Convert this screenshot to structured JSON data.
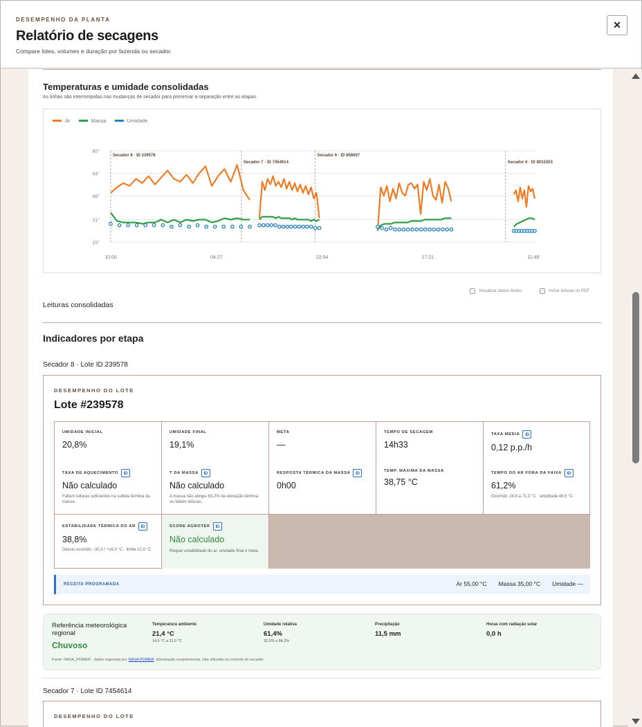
{
  "header": {
    "eyebrow": "DESEMPENHO DA PLANTA",
    "title": "Relatório de secagens",
    "subtitle": "Compare lotes, volumes e duração por fazenda ou secador.",
    "close_label": "✕"
  },
  "temps_section": {
    "title": "Temperaturas e umidade consolidadas",
    "subtitle": "As linhas são interrompidas nas mudanças de secador para preservar a separação entre as etapas."
  },
  "chart_data": {
    "type": "line",
    "legend": [
      {
        "name": "Ar",
        "color": "#f07b22"
      },
      {
        "name": "Massa",
        "color": "#2e9e44"
      },
      {
        "name": "Umidade",
        "color": "#1f7fbf"
      }
    ],
    "y_ticks": [
      "80°",
      "64°",
      "48°",
      "31°",
      "15°"
    ],
    "x_ticks": [
      "10:00",
      "04:27",
      "22:54",
      "17:21",
      "11:48"
    ],
    "ylim": [
      15,
      80
    ],
    "markers": [
      {
        "label": "Secador 8 · ID 239578"
      },
      {
        "label": "Secador 7 · ID 7454614"
      },
      {
        "label": "Secador 6 · ID 858607"
      },
      {
        "label": "Secador 6 · ID 8015303"
      }
    ],
    "segments": [
      {
        "x": [
          0,
          10
        ],
        "ar": [
          50,
          54,
          57,
          55,
          60,
          57,
          62,
          56,
          61,
          66,
          60,
          58,
          63,
          57,
          64,
          69,
          55,
          62,
          67,
          58,
          70,
          52,
          45
        ],
        "massa": [
          36,
          30,
          29,
          29,
          29,
          28,
          29,
          29,
          31,
          29,
          31,
          29,
          31,
          30,
          31,
          31,
          29,
          30,
          32,
          31,
          32,
          31,
          31
        ],
        "umidade": [
          28,
          27,
          27,
          27,
          27,
          27,
          27,
          26,
          27,
          26,
          27,
          26,
          26,
          26,
          26,
          26,
          26
        ]
      },
      {
        "x": [
          10.7,
          15
        ],
        "ar": [
          32,
          58,
          52,
          60,
          56,
          62,
          55,
          58,
          54,
          60,
          53,
          58,
          52,
          57,
          51,
          56,
          50,
          55,
          49,
          54,
          46,
          50,
          32
        ],
        "massa": [
          31,
          33,
          33,
          33,
          33,
          33,
          32,
          33,
          32,
          32,
          32,
          32,
          31,
          32,
          31,
          31,
          31,
          31,
          31,
          30,
          31,
          30,
          31
        ],
        "umidade": [
          27,
          27,
          27,
          27,
          27,
          26,
          26,
          26,
          26,
          26,
          26,
          26,
          26,
          26,
          25,
          25
        ]
      },
      {
        "x": [
          19.2,
          24.5
        ],
        "ar": [
          23,
          54,
          48,
          55,
          44,
          53,
          46,
          57,
          50,
          48,
          56,
          57,
          53,
          56,
          35,
          58,
          52,
          60,
          48,
          45,
          56,
          43,
          58,
          53,
          44
        ],
        "massa": [
          24,
          27,
          28,
          28,
          28,
          29,
          29,
          29,
          29,
          29,
          30,
          30,
          30,
          30,
          31,
          31,
          31,
          31,
          31,
          31,
          32,
          32,
          32
        ],
        "umidade": [
          26,
          25,
          24,
          25,
          24,
          24,
          24,
          24,
          24,
          24,
          24,
          24,
          24,
          24,
          24,
          24,
          24,
          24
        ]
      },
      {
        "x": [
          29,
          30.5
        ],
        "ar": [
          49,
          52,
          44,
          54,
          46,
          52,
          40,
          55,
          51,
          53,
          46
        ],
        "massa": [
          26,
          28,
          29,
          30,
          31,
          32,
          32,
          31
        ],
        "umidade": [
          23,
          23,
          23,
          23,
          23,
          23,
          23,
          23,
          23
        ]
      }
    ]
  },
  "checks": {
    "raw": "Visualizar dados brutos",
    "pdf": "Incluir leituras no PDF"
  },
  "readings_title": "Leituras consolidadas",
  "indicators_title": "Indicadores por etapa",
  "stage1": {
    "title": "Secador 8 · Lote ID 239578",
    "eyebrow": "DESEMPENHO DO LOTE",
    "lot_title": "Lote #239578",
    "metrics": {
      "umidade_inicial": {
        "label": "UMIDADE INICIAL",
        "value": "20,8%"
      },
      "umidade_final": {
        "label": "UMIDADE FINAL",
        "value": "19,1%"
      },
      "meta": {
        "label": "META",
        "value": "—"
      },
      "tempo_secagem": {
        "label": "TEMPO DE SECAGEM",
        "value": "14h33"
      },
      "taxa_media": {
        "label": "TAXA MÉDIA",
        "value": "0,12 p.p./h"
      },
      "taxa_aquecimento": {
        "label": "TAXA DE AQUECIMENTO",
        "value": "Não calculado",
        "note": "Faltam leituras suficientes na subida térmica da massa."
      },
      "t_massa": {
        "label": "T DA MASSA",
        "value": "Não calculado",
        "note": "A massa não atingiu 63,2% da elevação térmica ou faltam leituras."
      },
      "resposta_termica": {
        "label": "RESPOSTA TÉRMICA DA MASSA",
        "value": "0h00"
      },
      "temp_maxima": {
        "label": "TEMP. MÁXIMA DA MASSA",
        "value": "38,75 °C"
      },
      "tempo_ar_fora": {
        "label": "TEMPO DO AR FORA DA FAIXA",
        "value": "61,2%",
        "note": "Ocorrido: 24,8 a 71,3 °C · amplitude 46,5 °C"
      },
      "estabilidade": {
        "label": "ESTABILIDADE TÉRMICA DO AR",
        "value": "38,8%",
        "note": "Desvio ocorrido: -30,3 / +16,3 °C · limite ±2,0 °C"
      },
      "score": {
        "label": "SCORE AGROTEK",
        "value": "Não calculado",
        "note": "Requer estabilidade do ar, umidade final e meta."
      }
    },
    "recipe": {
      "label": "RECEITA PROGRAMADA",
      "ar": "Ar 55,00 °C",
      "massa": "Massa 35,00 °C",
      "umidade": "Umidade —"
    },
    "weather": {
      "title": "Referência meteorológica regional",
      "status": "Chuvoso",
      "temp_label": "Temperatura ambiente",
      "temp_value": "21,4 °C",
      "temp_range": "14,6 °C a 31,0 °C",
      "hum_label": "Umidade relativa",
      "hum_value": "61,4%",
      "hum_range": "32,5% a 84,2%",
      "precip_label": "Precipitação",
      "precip_value": "11,5 mm",
      "sun_label": "Horas com radiação solar",
      "sun_value": "0,0 h",
      "source_prefix": "Fonte: NASA_POWER · dados regionais por ",
      "source_link": "NASA POWER",
      "source_suffix": ". Informação complementar, não utilizada no controle do secador."
    }
  },
  "stage2": {
    "title": "Secador 7 · Lote ID 7454614",
    "eyebrow": "DESEMPENHO DO LOTE"
  },
  "info_icon_text": "ID"
}
